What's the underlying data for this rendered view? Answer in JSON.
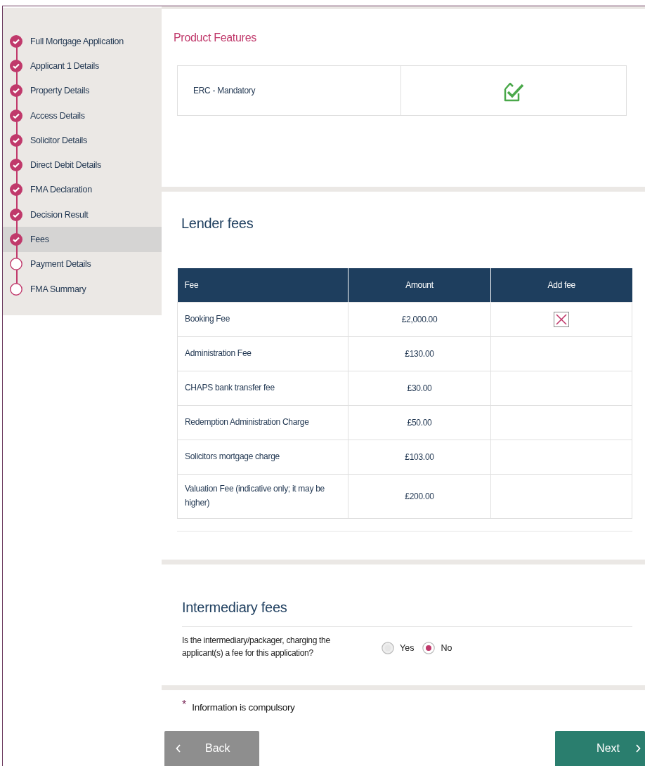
{
  "sidebar": {
    "items": [
      {
        "label": "Full Mortgage Application",
        "complete": true,
        "selected": false
      },
      {
        "label": "Applicant 1 Details",
        "complete": true,
        "selected": false
      },
      {
        "label": "Property Details",
        "complete": true,
        "selected": false
      },
      {
        "label": "Access Details",
        "complete": true,
        "selected": false
      },
      {
        "label": "Solicitor Details",
        "complete": true,
        "selected": false
      },
      {
        "label": "Direct Debit Details",
        "complete": true,
        "selected": false
      },
      {
        "label": "FMA Declaration",
        "complete": true,
        "selected": false
      },
      {
        "label": "Decision Result",
        "complete": true,
        "selected": false
      },
      {
        "label": "Fees",
        "complete": true,
        "selected": true
      },
      {
        "label": "Payment Details",
        "complete": false,
        "selected": false
      },
      {
        "label": "FMA Summary",
        "complete": false,
        "selected": false
      }
    ]
  },
  "product_features": {
    "title": "Product Features",
    "rows": [
      {
        "label": "ERC - Mandatory",
        "included": true
      }
    ]
  },
  "lender_fees": {
    "title": "Lender fees",
    "columns": [
      "Fee",
      "Amount",
      "Add fee"
    ],
    "rows": [
      {
        "fee": "Booking Fee",
        "amount": "£2,000.00",
        "add_fee_box": true
      },
      {
        "fee": "Administration Fee",
        "amount": "£130.00",
        "add_fee_box": false
      },
      {
        "fee": "CHAPS bank transfer fee",
        "amount": "£30.00",
        "add_fee_box": false
      },
      {
        "fee": "Redemption Administration Charge",
        "amount": "£50.00",
        "add_fee_box": false
      },
      {
        "fee": "Solicitors mortgage charge",
        "amount": "£103.00",
        "add_fee_box": false
      },
      {
        "fee": "Valuation Fee (indicative only; it may be higher)",
        "amount": "£200.00",
        "add_fee_box": false
      }
    ]
  },
  "intermediary_fees": {
    "title": "Intermediary fees",
    "question": "Is the intermediary/packager, charging the applicant(s) a fee for this application?",
    "options": [
      {
        "label": "Yes",
        "selected": false
      },
      {
        "label": "No",
        "selected": true
      }
    ]
  },
  "compulsory_note": {
    "mark": "*",
    "text": "Information is compulsory"
  },
  "buttons": [
    {
      "label": "Back",
      "kind": "back"
    },
    {
      "label": "Next",
      "kind": "next"
    }
  ]
}
